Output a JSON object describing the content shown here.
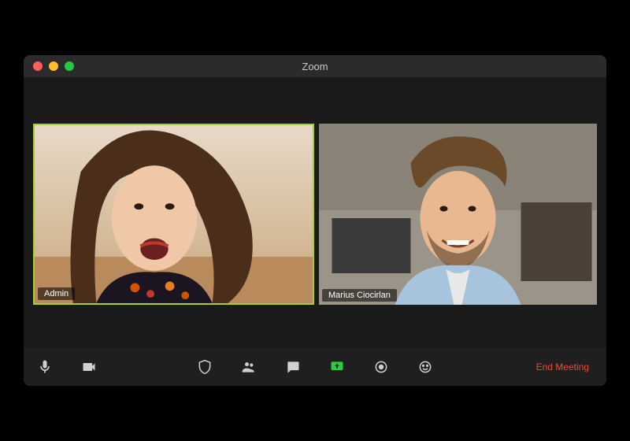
{
  "window": {
    "title": "Zoom"
  },
  "participants": [
    {
      "name": "Admin",
      "active": true
    },
    {
      "name": "Marius Ciocirlan",
      "active": false
    }
  ],
  "toolbar": {
    "mute_label": "Mute",
    "video_label": "Video",
    "security_label": "Security",
    "participants_label": "Participants",
    "chat_label": "Chat",
    "share_label": "Share Screen",
    "record_label": "Record",
    "reactions_label": "Reactions",
    "end_label": "End Meeting"
  },
  "icons": {
    "mic": "microphone-icon",
    "video": "video-camera-icon",
    "security": "shield-icon",
    "participants": "participants-icon",
    "chat": "chat-icon",
    "share": "share-screen-icon",
    "record": "record-icon",
    "reactions": "reactions-icon"
  }
}
